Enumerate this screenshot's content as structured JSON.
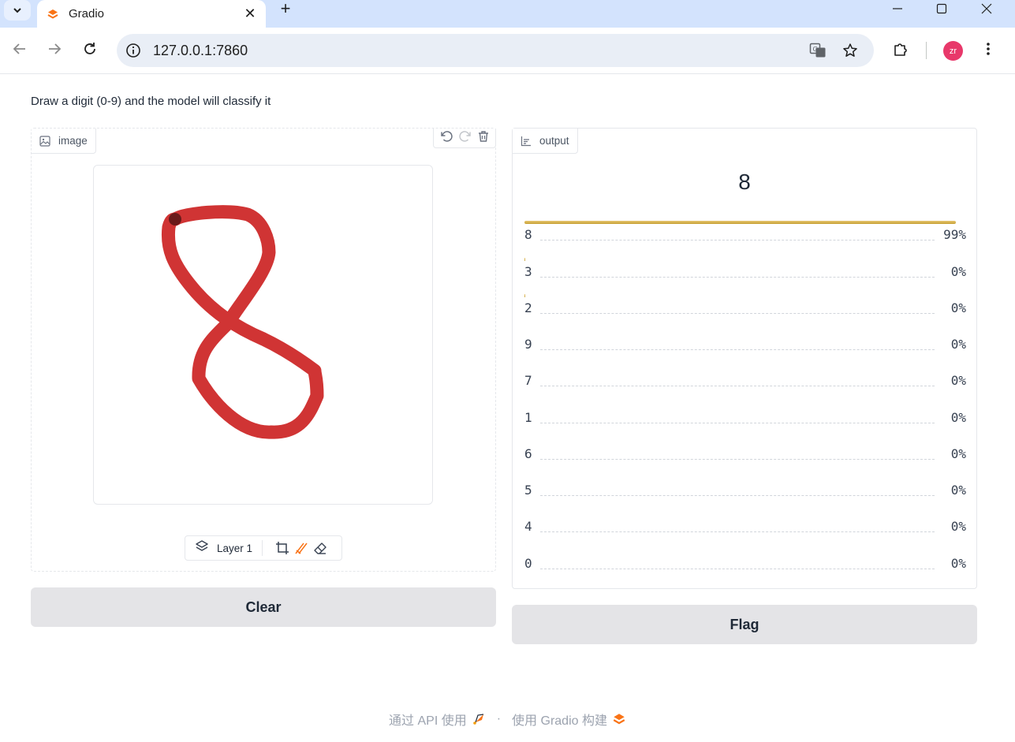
{
  "browser": {
    "tab_title": "Gradio",
    "url": "127.0.0.1:7860",
    "profile_initials": "zr"
  },
  "page": {
    "description": "Draw a digit (0-9) and the model will classify it"
  },
  "input_panel": {
    "label": "image",
    "layer_label": "Layer 1",
    "brush_color": "#d03434"
  },
  "output_panel": {
    "label": "output",
    "predicted": "8",
    "confidences": [
      {
        "label": "8",
        "value": "99%",
        "fraction": 0.99
      },
      {
        "label": "3",
        "value": "0%",
        "fraction": 0.002
      },
      {
        "label": "2",
        "value": "0%",
        "fraction": 0.001
      },
      {
        "label": "9",
        "value": "0%",
        "fraction": 0
      },
      {
        "label": "7",
        "value": "0%",
        "fraction": 0
      },
      {
        "label": "1",
        "value": "0%",
        "fraction": 0
      },
      {
        "label": "6",
        "value": "0%",
        "fraction": 0
      },
      {
        "label": "5",
        "value": "0%",
        "fraction": 0
      },
      {
        "label": "4",
        "value": "0%",
        "fraction": 0
      },
      {
        "label": "0",
        "value": "0%",
        "fraction": 0
      }
    ]
  },
  "buttons": {
    "clear": "Clear",
    "flag": "Flag"
  },
  "footer": {
    "api_text": "通过 API 使用",
    "separator": "·",
    "built_text": "使用 Gradio 构建"
  },
  "colors": {
    "accent": "#f97316",
    "bar": "#d4af37"
  }
}
